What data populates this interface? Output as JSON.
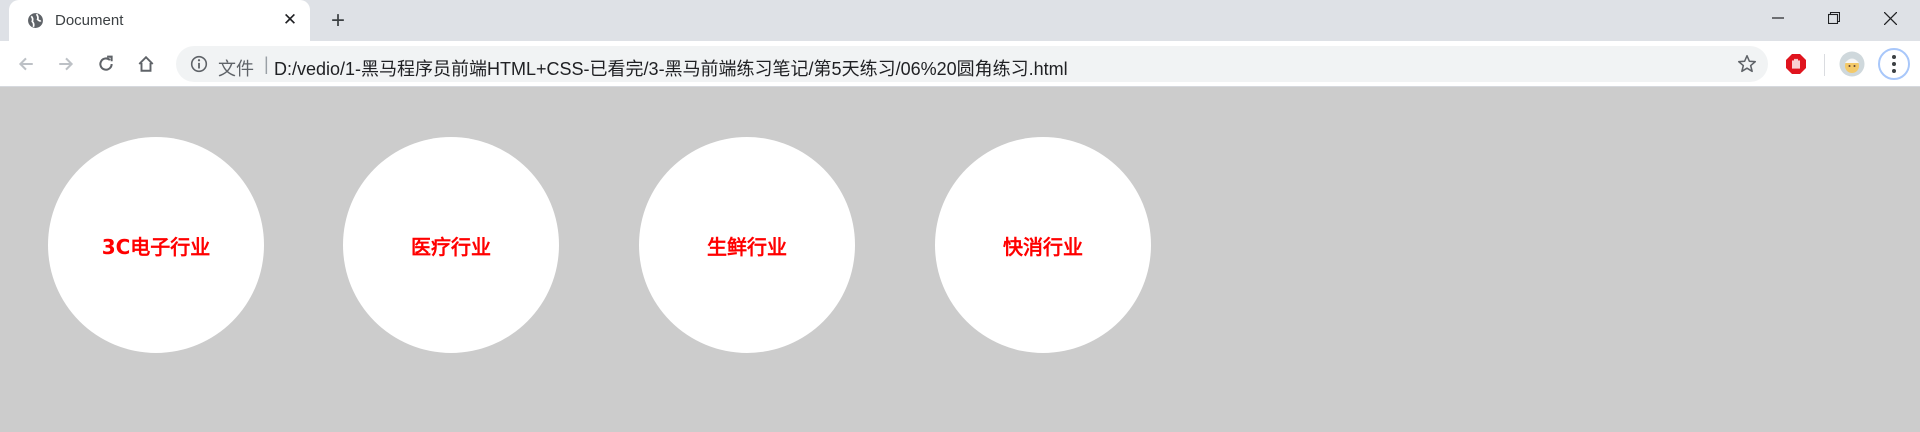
{
  "browser": {
    "tab": {
      "title": "Document",
      "favicon": "globe-icon"
    },
    "address": {
      "scheme_label": "文件",
      "separator": "|",
      "url": "D:/vedio/1-黑马程序员前端HTML+CSS-已看完/3-黑马前端练习笔记/第5天练习/06%20圆角练习.html"
    }
  },
  "page": {
    "background": "#cccccc",
    "circle_color": "#ffffff",
    "text_color": "#ff0000",
    "circles": [
      {
        "label": "3C电子行业"
      },
      {
        "label": "医疗行业"
      },
      {
        "label": "生鲜行业"
      },
      {
        "label": "快消行业"
      }
    ]
  }
}
